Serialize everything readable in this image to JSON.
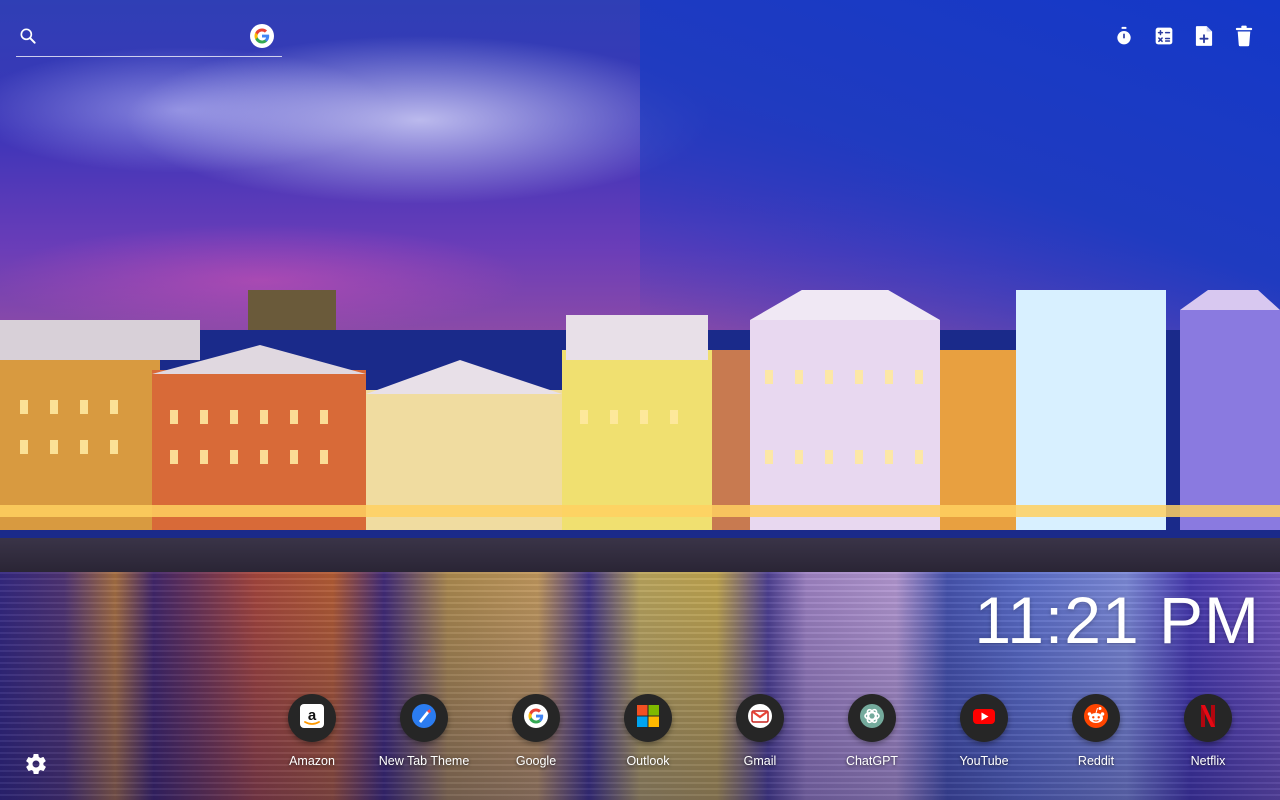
{
  "search": {
    "placeholder": "",
    "value": "",
    "engine_icon": "google-g-icon"
  },
  "toolbar": [
    {
      "name": "timer-icon"
    },
    {
      "name": "calculator-icon"
    },
    {
      "name": "new-note-icon"
    },
    {
      "name": "trash-icon"
    }
  ],
  "clock": {
    "time": "11:21 PM"
  },
  "shortcuts": [
    {
      "label": "Amazon",
      "icon": "amazon-icon"
    },
    {
      "label": "New Tab Theme",
      "icon": "new-tab-theme-icon"
    },
    {
      "label": "Google",
      "icon": "google-icon"
    },
    {
      "label": "Outlook",
      "icon": "outlook-icon"
    },
    {
      "label": "Gmail",
      "icon": "gmail-icon"
    },
    {
      "label": "ChatGPT",
      "icon": "chatgpt-icon"
    },
    {
      "label": "YouTube",
      "icon": "youtube-icon"
    },
    {
      "label": "Reddit",
      "icon": "reddit-icon"
    },
    {
      "label": "Netflix",
      "icon": "netflix-icon"
    }
  ],
  "settings": {
    "icon": "gear-icon"
  },
  "colors": {
    "text": "#ffffff",
    "shortcut_bg": "#262626",
    "youtube_red": "#ff0000",
    "reddit_orange": "#ff4500",
    "netflix_red": "#e50914"
  }
}
